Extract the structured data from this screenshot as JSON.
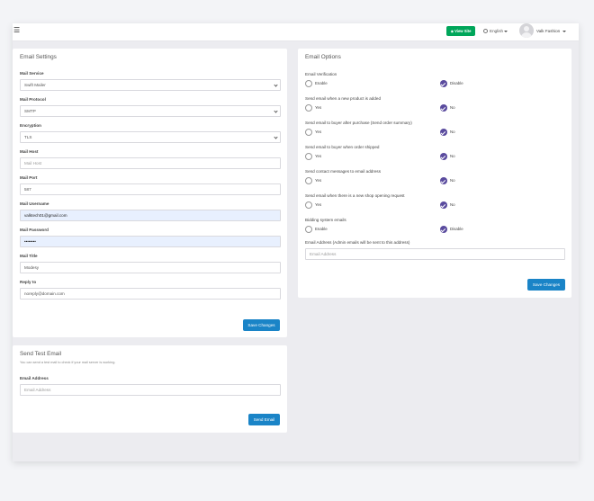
{
  "topbar": {
    "view_site_label": "View Site",
    "language_label": "English",
    "user_name": "Valk Fashion"
  },
  "email_settings": {
    "title": "Email Settings",
    "mail_service": {
      "label": "Mail Service",
      "value": "Swift Mailer"
    },
    "mail_protocol": {
      "label": "Mail Protocol",
      "value": "SMTP"
    },
    "encryption": {
      "label": "Encryption",
      "value": "TLS"
    },
    "mail_host": {
      "label": "Mail Host",
      "placeholder": "Mail Host"
    },
    "mail_port": {
      "label": "Mail Port",
      "value": "587"
    },
    "mail_username": {
      "label": "Mail Username",
      "value": "valktech01@gmail.com"
    },
    "mail_password": {
      "label": "Mail Password",
      "value": "••••••••"
    },
    "mail_title": {
      "label": "Mail Title",
      "value": "Modesy"
    },
    "reply_to": {
      "label": "Reply to",
      "value": "noreply@domain.com"
    },
    "save_label": "Save Changes"
  },
  "test_email": {
    "title": "Send Test Email",
    "help": "You can send a test mail to check if your mail server is working.",
    "email_label": "Email Address",
    "email_placeholder": "Email Address",
    "send_label": "Send Email"
  },
  "email_options": {
    "title": "Email Options",
    "options": [
      {
        "label": "Email Verification",
        "left": "Enable",
        "right": "Disable",
        "selected": "right"
      },
      {
        "label": "Send email when a new product is added",
        "left": "Yes",
        "right": "No",
        "selected": "right"
      },
      {
        "label": "Send email to buyer after purchase (Send order summary)",
        "left": "Yes",
        "right": "No",
        "selected": "right"
      },
      {
        "label": "Send email to buyer when order shipped",
        "left": "Yes",
        "right": "No",
        "selected": "right"
      },
      {
        "label": "Send contact messages to email address",
        "left": "Yes",
        "right": "No",
        "selected": "right"
      },
      {
        "label": "Send email when there is a new shop opening request",
        "left": "Yes",
        "right": "No",
        "selected": "right"
      },
      {
        "label": "Bidding system emails",
        "left": "Enable",
        "right": "Disable",
        "selected": "right"
      }
    ],
    "admin_email_label": "Email Address (Admin emails will be sent to this address)",
    "admin_email_placeholder": "Email Address",
    "save_label": "Save Changes"
  },
  "colors": {
    "primary_button": "#1a84c7",
    "view_site": "#00a65a",
    "radio_checked": "#5a4b9e",
    "autofill": "#e8f0fe"
  }
}
